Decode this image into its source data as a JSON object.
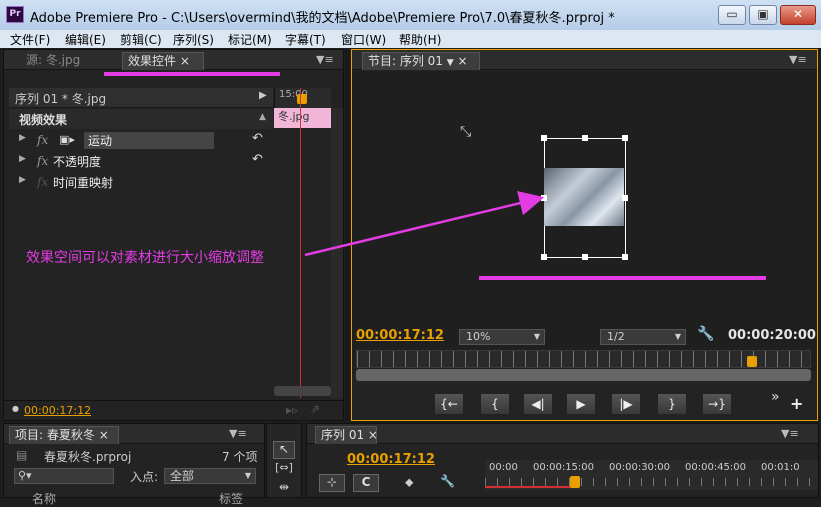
{
  "window": {
    "title": "Adobe Premiere Pro - C:\\Users\\overmind\\我的文档\\Adobe\\Premiere Pro\\7.0\\春夏秋冬.prproj *",
    "app_icon": "Pr"
  },
  "window_controls": {
    "minimize": "▭",
    "maximize": "▣",
    "close": "✕"
  },
  "menu": [
    "文件(F)",
    "编辑(E)",
    "剪辑(C)",
    "序列(S)",
    "标记(M)",
    "字幕(T)",
    "窗口(W)",
    "帮助(H)"
  ],
  "left_panel": {
    "tabs": {
      "source": "源: 冬.jpg",
      "effect_controls": "效果控件",
      "close": "×",
      "menu": "▼≡"
    },
    "header": "序列 01 * 冬.jpg",
    "section": "视频效果",
    "effects": [
      {
        "fx": "fx",
        "label": "运动",
        "icon": "▣▸"
      },
      {
        "fx": "fx",
        "label": "不透明度",
        "icon": ""
      },
      {
        "fx": "fx",
        "label": "时间重映射",
        "icon": ""
      }
    ],
    "timeline_time": "15:00",
    "clip_label": "冬.jpg",
    "footer_time": "00:00:17:12"
  },
  "program_monitor": {
    "tab": "节目: 序列 01",
    "tab_close": "×",
    "menu": "▼≡",
    "current_time": "00:00:17:12",
    "zoom": "10%",
    "resolution": "1/2",
    "duration": "00:00:20:00",
    "buttons": [
      "{←",
      "{",
      "◀|",
      "▶",
      "|▶",
      "}",
      "→}"
    ],
    "extra": "»",
    "add": "+"
  },
  "annotation": {
    "text": "效果空间可以对素材进行大小缩放调整"
  },
  "project_panel": {
    "tab": "项目: 春夏秋冬",
    "tab_close": "×",
    "menu": "▼≡",
    "file": "春夏秋冬.prproj",
    "count": "7 个项",
    "search_placeholder": "",
    "inpoint_label": "入点:",
    "inpoint_value": "全部",
    "col_name": "名称",
    "col_label": "标签"
  },
  "timeline_panel": {
    "tab": "序列 01",
    "tab_close": "×",
    "menu": "▼≡",
    "current_time": "00:00:17:12",
    "ruler": [
      "00:00",
      "00:00:15:00",
      "00:00:30:00",
      "00:00:45:00",
      "00:01:0"
    ]
  },
  "colors": {
    "accent": "#e8a000",
    "annotation": "#e43ce4",
    "clip": "#f2b7d8"
  }
}
